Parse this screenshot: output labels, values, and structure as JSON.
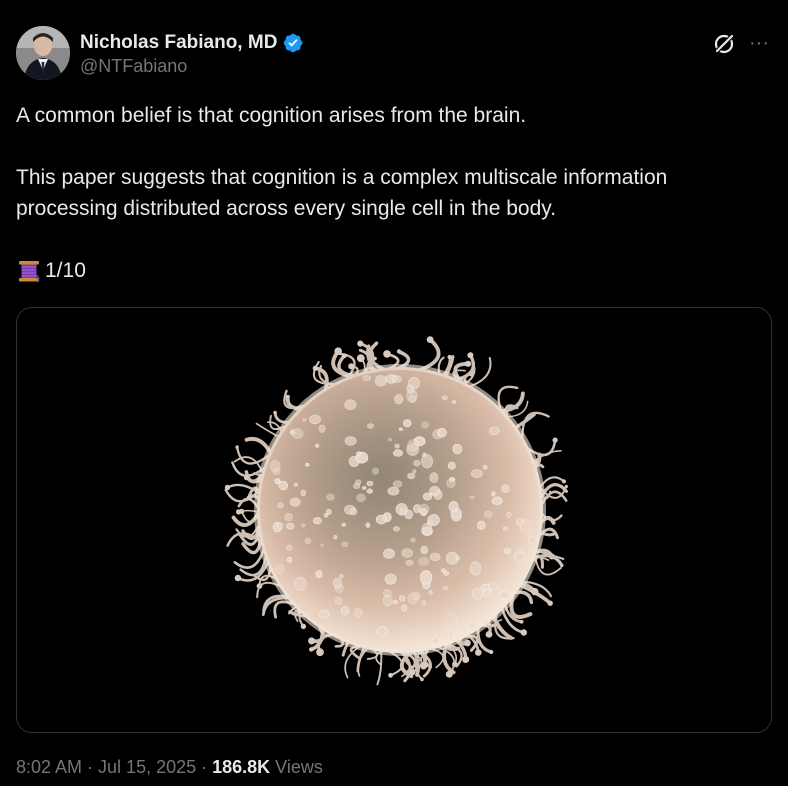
{
  "author": {
    "display_name": "Nicholas Fabiano, MD",
    "handle": "@NTFabiano",
    "verified": true
  },
  "icons": {
    "avatar": "avatar-photo",
    "verified": "verified-badge-icon",
    "grok": "grok-icon",
    "more": "more-icon",
    "thread": "spool-of-thread-icon",
    "verified_color": "#1d9bf0"
  },
  "more_glyph": "···",
  "tweet": {
    "paragraph_1": "A common belief is that cognition arises from the brain.",
    "paragraph_2": "This paper suggests that cognition is a complex multiscale information processing distributed across every single cell in the body.",
    "thread_counter": "1/10"
  },
  "media": {
    "alt": "Scanning electron micrograph of a single spherical cell covered in surface projections"
  },
  "footer": {
    "time": "8:02 AM",
    "separator": "·",
    "date": "Jul 15, 2025",
    "views_count": "186.8K",
    "views_label": "Views"
  },
  "colors": {
    "background": "#000000",
    "text_primary": "#e7e9ea",
    "text_secondary": "#71767b",
    "border": "#2f3336"
  }
}
